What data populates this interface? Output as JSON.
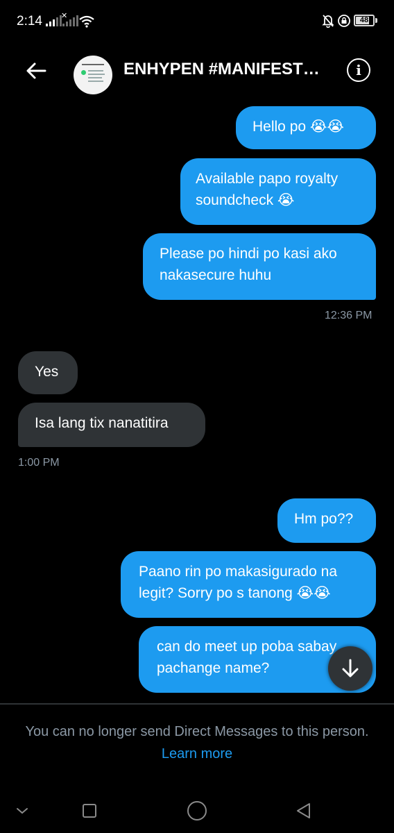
{
  "status_bar": {
    "time": "2:14",
    "battery": "48",
    "icons": [
      "signal-icon",
      "signal-no-service-icon",
      "wifi-icon",
      "bell-off-icon",
      "rotation-lock-icon",
      "battery-icon"
    ]
  },
  "header": {
    "contact_name": "ENHYPEN #MANIFEST…",
    "back_icon": "arrow-left-icon",
    "info_icon": "info-icon"
  },
  "messages": [
    {
      "side": "out",
      "text": "Hello po 😭😭"
    },
    {
      "side": "out",
      "lines": [
        "Available papo royalty",
        "soundcheck 😭"
      ]
    },
    {
      "side": "out",
      "lines": [
        "Please po hindi po kasi ako",
        "nakasecure huhu"
      ]
    },
    {
      "side": "in",
      "text": "Yes"
    },
    {
      "side": "in",
      "text": "Isa lang tix nanatitira"
    },
    {
      "side": "out",
      "text": "Hm po??"
    },
    {
      "side": "out",
      "lines": [
        "Paano rin po makasigurado na",
        "legit? Sorry po s tanong 😭😭"
      ]
    },
    {
      "side": "out",
      "lines": [
        "can do meet up poba sabay",
        "pachange name?"
      ]
    }
  ],
  "timestamps": {
    "first": "12:36 PM",
    "second": "1:00 PM"
  },
  "footer": {
    "notice": "You can no longer send Direct Messages to this person.",
    "link": "Learn more"
  },
  "navbar": {
    "items": [
      "chevron-down-icon",
      "recent-apps-icon",
      "home-icon",
      "back-icon"
    ]
  },
  "colors": {
    "background": "#000000",
    "outgoing_bubble": "#1d9bf0",
    "incoming_bubble": "#2f3336",
    "muted_text": "#8b98a5",
    "link": "#1d9bf0"
  }
}
